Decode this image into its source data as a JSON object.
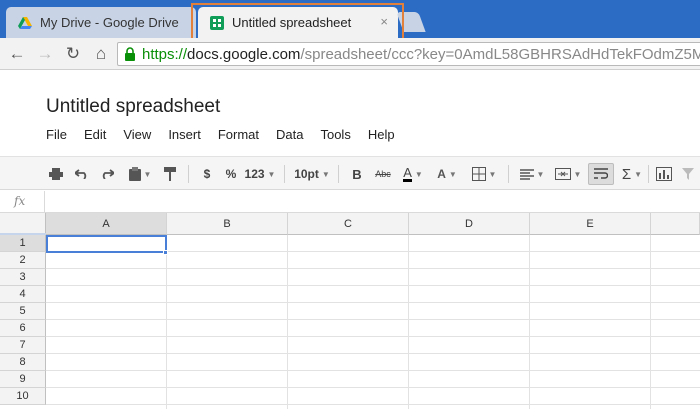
{
  "browser": {
    "tabs": [
      {
        "title": "My Drive - Google Drive",
        "active": false,
        "icon": "google-drive-icon"
      },
      {
        "title": "Untitled spreadsheet",
        "active": true,
        "icon": "google-sheets-icon",
        "close": "×"
      }
    ],
    "address": {
      "scheme": "https://",
      "host": "docs.google.com",
      "path": "/spreadsheet/ccc?key=0AmdL58GBHRSAdHdTekFOdmZ5M"
    },
    "nav": {
      "back": "←",
      "forward": "→",
      "reload": "↻",
      "home": "⌂"
    }
  },
  "doc": {
    "title": "Untitled spreadsheet",
    "menu": [
      "File",
      "Edit",
      "View",
      "Insert",
      "Format",
      "Data",
      "Tools",
      "Help"
    ]
  },
  "toolbar": {
    "print": "print-icon",
    "undo": "undo-icon",
    "redo": "redo-icon",
    "paste_format": "clipboard-icon",
    "paint_format": "paint-format-icon",
    "currency": "$",
    "percent": "%",
    "number_format": "123",
    "font_size": "10pt",
    "bold": "B",
    "strikethrough": "Abc",
    "text_color_label": "A",
    "fill_color_label": "A",
    "borders": "borders-icon",
    "align": "align-left-icon",
    "merge": "merge-cells-icon",
    "wrap": "wrap-text-icon",
    "functions": "Σ",
    "chart": "chart-icon",
    "filter": "filter-icon"
  },
  "formula_bar": {
    "fx": "fx"
  },
  "grid": {
    "columns": [
      "A",
      "B",
      "C",
      "D",
      "E"
    ],
    "rows": [
      "1",
      "2",
      "3",
      "4",
      "5",
      "6",
      "7",
      "8",
      "9",
      "10"
    ],
    "active_cell": "A1"
  },
  "colors": {
    "tab_strip": "#2d6cc5",
    "highlight": "#e0803a",
    "https_green": "#0a8f08",
    "selection_blue": "#4a7fd8"
  }
}
